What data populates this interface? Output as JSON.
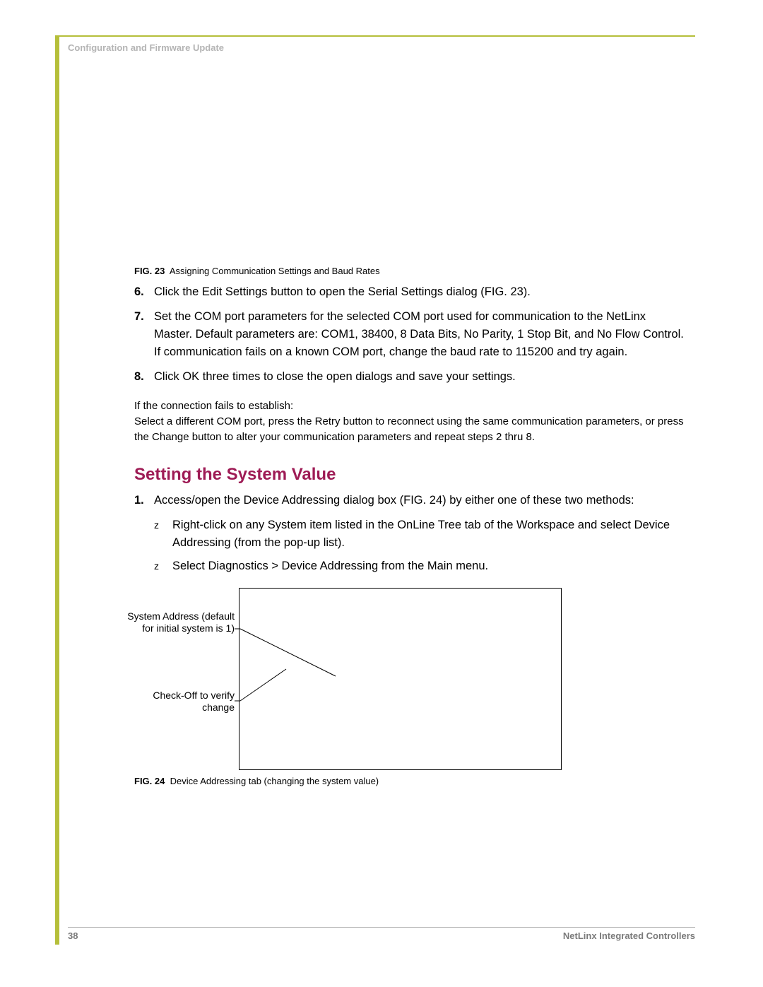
{
  "header": {
    "section_label": "Configuration and Firmware Update"
  },
  "fig23": {
    "num": "FIG. 23",
    "caption": "Assigning Communication Settings and Baud Rates"
  },
  "steps_top": [
    {
      "n": "6.",
      "text": "Click the Edit Settings button to open the Serial Settings dialog (FIG. 23)."
    },
    {
      "n": "7.",
      "text": "Set the COM port parameters for the selected COM port used for communication to the NetLinx Master. Default parameters are: COM1, 38400, 8 Data Bits, No Parity, 1 Stop Bit, and No Flow Control. If communication fails on a known COM port, change the baud rate to 115200 and try again."
    },
    {
      "n": "8.",
      "text": "Click OK three times to close the open dialogs and save your settings."
    }
  ],
  "troubleshoot": {
    "line1": "If the connection fails to establish:",
    "line2": "Select a different COM port, press the Retry button to reconnect using the same communication parameters, or press the Change button to alter your communication parameters and repeat steps 2 thru 8."
  },
  "section_heading": "Setting the System Value",
  "steps_section": [
    {
      "n": "1.",
      "text": "Access/open the Device Addressing dialog box (FIG. 24) by either one of these two methods:"
    }
  ],
  "sub_bullets": [
    {
      "b": "z",
      "text": "Right-click on any System item listed in the OnLine Tree tab of the Workspace and select Device Addressing (from the pop-up list)."
    },
    {
      "b": "z",
      "text": "Select Diagnostics > Device Addressing from the Main menu."
    }
  ],
  "fig24": {
    "callout1": "System Address (default for initial system is 1)",
    "callout2": "Check-Off to verify change",
    "num": "FIG. 24",
    "caption": "Device Addressing tab (changing the system value)"
  },
  "footer": {
    "page": "38",
    "doc": "NetLinx Integrated Controllers"
  }
}
